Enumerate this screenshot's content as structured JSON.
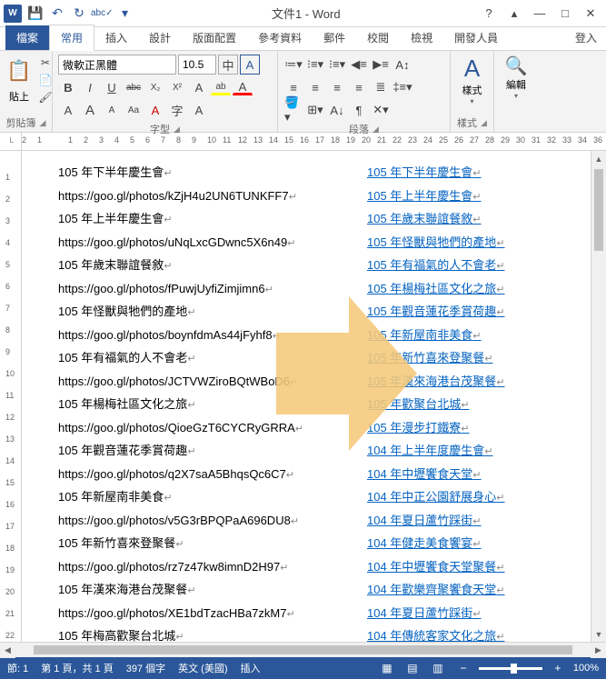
{
  "title": "文件1 - Word",
  "qat": {
    "save": "💾",
    "undo": "↶",
    "redo": "↻",
    "abc": "abc✓",
    "more": "▾"
  },
  "win": {
    "help": "?",
    "ribbon": "▴",
    "min": "—",
    "max": "□",
    "close": "✕"
  },
  "tabs": {
    "file": "檔案",
    "home": "常用",
    "insert": "插入",
    "design": "設計",
    "layout": "版面配置",
    "ref": "參考資料",
    "mail": "郵件",
    "review": "校閱",
    "view": "檢視",
    "dev": "開發人員",
    "login": "登入"
  },
  "ribbon": {
    "clipboard": {
      "label": "剪貼簿",
      "paste": "貼上"
    },
    "font": {
      "label": "字型",
      "name": "微軟正黑體",
      "size": "10.5",
      "zhong": "中",
      "A_arrow": "A",
      "b": "B",
      "i": "I",
      "u": "U",
      "abc": "abc",
      "x2": "X₂",
      "x2b": "X²",
      "Aa": "A",
      "highlight": "ab",
      "color": "A",
      "grow": "A",
      "shrink": "A",
      "Aa2": "Aa",
      "clear": "A",
      "enclose": "字",
      "border": "A"
    },
    "para": {
      "label": "段落"
    },
    "styles": {
      "label": "樣式",
      "btn": "樣式"
    },
    "edit": {
      "label": "編輯",
      "btn": "編輯",
      "icon": "🔍"
    }
  },
  "ruler_h": [
    "2",
    "1",
    "",
    "1",
    "2",
    "3",
    "4",
    "5",
    "6",
    "7",
    "8",
    "9",
    "10",
    "11",
    "12",
    "13",
    "14",
    "15",
    "16",
    "17",
    "18",
    "19",
    "20",
    "21",
    "22",
    "23",
    "24",
    "25",
    "26",
    "27",
    "28",
    "29",
    "30",
    "31",
    "32",
    "33",
    "34",
    "36"
  ],
  "ruler_v": [
    "",
    "1",
    "2",
    "3",
    "4",
    "5",
    "6",
    "7",
    "8",
    "9",
    "10",
    "11",
    "12",
    "13",
    "14",
    "15",
    "16",
    "17",
    "18",
    "19",
    "20",
    "21",
    "22"
  ],
  "doc_left": [
    "105 年下半年慶生會",
    "https://goo.gl/photos/kZjH4u2UN6TUNKFF7",
    "105 年上半年慶生會",
    "https://goo.gl/photos/uNqLxcGDwnc5X6n49",
    "105 年歲末聯誼餐敘",
    "https://goo.gl/photos/fPuwjUyfiZimjimn6",
    "105 年怪獸與牠們的產地",
    "https://goo.gl/photos/boynfdmAs44jFyhf8",
    "105 年有福氣的人不會老",
    "https://goo.gl/photos/JCTVWZiroBQtWBoD6",
    "105 年楊梅社區文化之旅",
    "https://goo.gl/photos/QioeGzT6CYCRyGRRA",
    "105 年觀音蓮花季賞荷趣",
    "https://goo.gl/photos/q2X7saA5BhqsQc6C7",
    "105 年新屋南非美食",
    "https://goo.gl/photos/v5G3rBPQPaA696DU8",
    "105 年新竹喜來登聚餐",
    "https://goo.gl/photos/rz7z47kw8imnD2H97",
    "105 年漢來海港台茂聚餐",
    "https://goo.gl/photos/XE1bdTzacHBa7zkM7",
    "105 年梅高歡聚台北城"
  ],
  "doc_right": [
    "105 年下半年慶生會",
    "105 年上半年慶生會",
    "105 年歲末聯誼餐敘",
    "105 年怪獸與牠們的產地",
    "105 年有福氣的人不會老",
    "105 年楊梅社區文化之旅",
    "105 年觀音蓮花季賞荷趣",
    "105 年新屋南非美食",
    "105 年新竹喜來登聚餐",
    "105 年漢來海港台茂聚餐",
    "105 年歡聚台北城",
    "105 年漫步打鐵寮",
    "104 年上半年度慶生會",
    "104 年中壢饗食天堂",
    "104 年中正公園舒展身心",
    "104 年夏日蘆竹踩街",
    "104 年健走美食饗宴",
    "104 年中壢饗食天堂聚餐",
    "104 年歡樂齊聚饗食天堂",
    "104 年夏日蘆竹踩街",
    "104 年傳統客家文化之旅"
  ],
  "status": {
    "section": "節:  1",
    "page": "第 1 頁，共 1 頁",
    "words": "397 個字",
    "lang": "英文 (美國)",
    "mode": "插入",
    "zoom": "100%",
    "plus": "+",
    "minus": "−"
  }
}
